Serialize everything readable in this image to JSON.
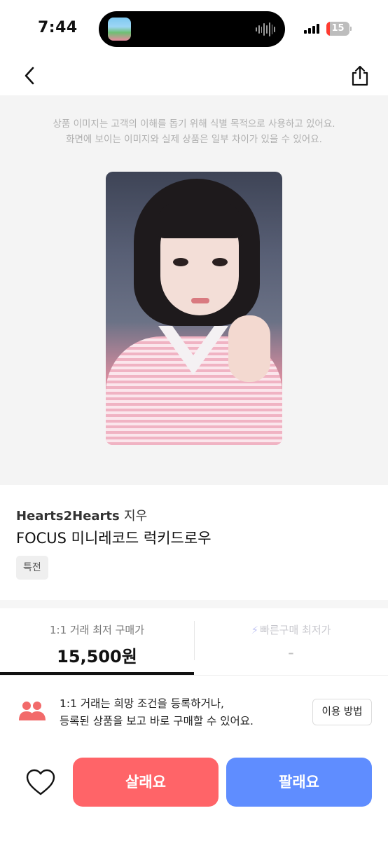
{
  "status_bar": {
    "time": "7:44",
    "battery_level": "15",
    "battery_fraction": 0.15
  },
  "nav": {
    "back_icon": "chevron-left-icon",
    "share_icon": "share-icon"
  },
  "image_area": {
    "notice_line1": "상품 이미지는 고객의 이해를 돕기 위해 식별 목적으로 사용하고 있어요.",
    "notice_line2": "화면에 보이는 이미지와 실제 상품은 일부 차이가 있을 수 있어요."
  },
  "product": {
    "artist": "Hearts2Hearts",
    "member": "지우",
    "title": "FOCUS 미니레코드 럭키드로우",
    "tag": "특전"
  },
  "price_tabs": [
    {
      "label": "1:1 거래 최저 구매가",
      "value": "15,500원",
      "selected": true
    },
    {
      "label": "빠른구매 최저가",
      "value": "-",
      "selected": false
    }
  ],
  "info": {
    "line1": "1:1 거래는 희망 조건을 등록하거나,",
    "line2": "등록된 상품을 보고 바로 구매할 수 있어요.",
    "how_button": "이용 방법",
    "icon": "people-icon"
  },
  "actions": {
    "buy_label": "살래요",
    "sell_label": "팔래요",
    "like_icon": "heart-icon"
  },
  "colors": {
    "buy": "#ff6468",
    "sell": "#5f8dff",
    "people_icon": "#f26a6a"
  }
}
